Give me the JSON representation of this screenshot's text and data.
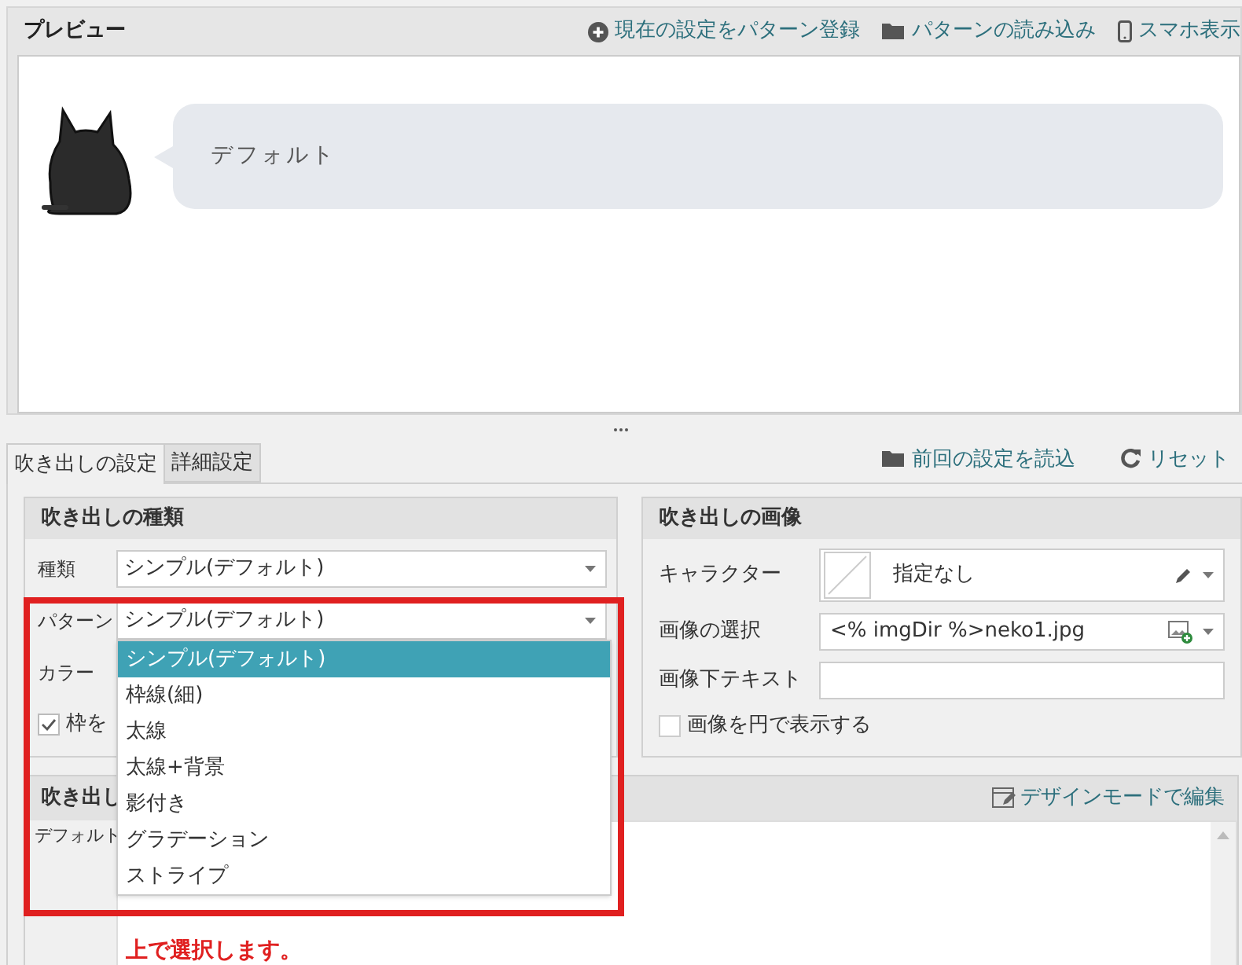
{
  "preview": {
    "title": "プレビュー",
    "actions": [
      {
        "label": "現在の設定をパターン登録"
      },
      {
        "label": "パターンの読み込み"
      },
      {
        "label": "スマホ表示"
      }
    ],
    "bubble_text": "デフォルト"
  },
  "tabs": [
    {
      "label": "吹き出しの設定",
      "selected": true
    },
    {
      "label": "詳細設定",
      "selected": false
    }
  ],
  "tab_actions": [
    {
      "label": "前回の設定を読込"
    },
    {
      "label": "リセット"
    }
  ],
  "bubble_type": {
    "title": "吹き出しの種類",
    "fields": [
      {
        "kind": "select",
        "label": "種類",
        "value": "シンプル(デフォルト)"
      },
      {
        "kind": "select",
        "label": "パターン",
        "value": "シンプル(デフォルト)"
      },
      {
        "kind": "label",
        "label": "カラー"
      },
      {
        "kind": "checkbox",
        "label": "枠を",
        "checked": true
      }
    ],
    "dropdown": [
      {
        "label": "シンプル(デフォルト)",
        "selected": true
      },
      {
        "label": "枠線(細)",
        "selected": false
      },
      {
        "label": "太線",
        "selected": false
      },
      {
        "label": "太線+背景",
        "selected": false
      },
      {
        "label": "影付き",
        "selected": false
      },
      {
        "label": "グラデーション",
        "selected": false
      },
      {
        "label": "ストライプ",
        "selected": false
      }
    ]
  },
  "bubble_image": {
    "title": "吹き出しの画像",
    "fields": [
      {
        "kind": "character",
        "label": "キャラクター",
        "value": "指定なし"
      },
      {
        "kind": "image",
        "label": "画像の選択",
        "value": "<% imgDir %>neko1.jpg"
      },
      {
        "kind": "text",
        "label": "画像下テキスト"
      },
      {
        "kind": "checkbox",
        "label": "画像を円で表示する",
        "checked": false
      }
    ]
  },
  "content": {
    "title": "吹き出し",
    "action": "デザインモードで編集",
    "label": "デフォルト",
    "annotation": "上で選択します。"
  }
}
